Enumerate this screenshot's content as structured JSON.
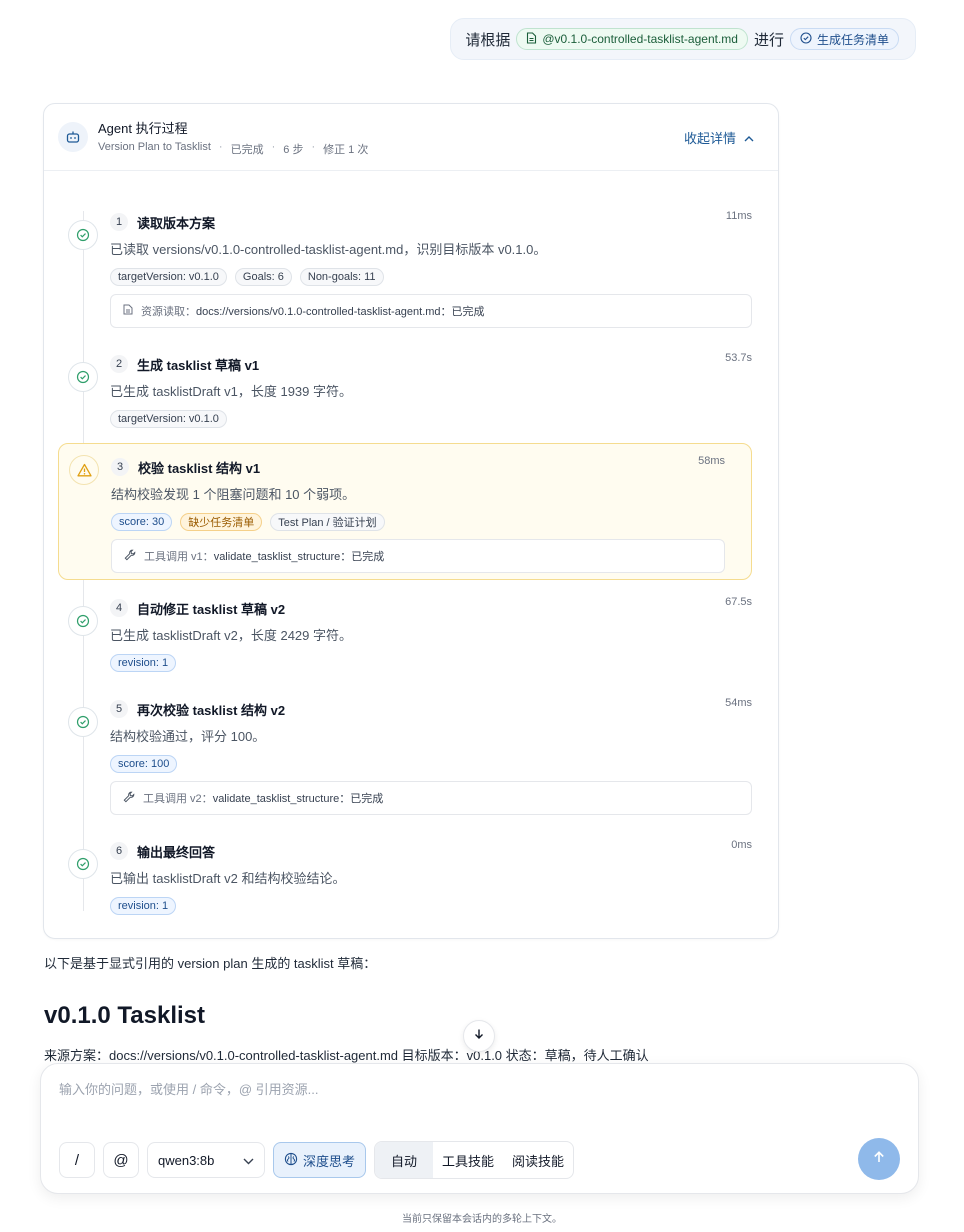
{
  "user_message": {
    "prefix": "请根据",
    "file_chip": "@v0.1.0-controlled-tasklist-agent.md",
    "middle": "进行",
    "action_chip": "生成任务清单"
  },
  "agent": {
    "title": "Agent 执行过程",
    "meta": [
      "Version Plan to Tasklist",
      "已完成",
      "6 步",
      "修正 1 次"
    ],
    "meta_sep": "·",
    "collapse_label": "收起详情",
    "steps": [
      {
        "num": "1",
        "title": "读取版本方案",
        "time": "11ms",
        "status": "done",
        "desc": "已读取 versions/v0.1.0-controlled-tasklist-agent.md，识别目标版本 v0.1.0。",
        "tags": [
          "targetVersion: v0.1.0",
          "Goals: 6",
          "Non-goals: 11"
        ],
        "box_label": "资源读取：",
        "box_value": "docs://versions/v0.1.0-controlled-tasklist-agent.md：已完成"
      },
      {
        "num": "2",
        "title": "生成 tasklist 草稿 v1",
        "time": "53.7s",
        "status": "done",
        "desc": "已生成 tasklistDraft v1，长度 1939 字符。",
        "tags": [
          "targetVersion: v0.1.0"
        ]
      },
      {
        "num": "3",
        "title": "校验 tasklist 结构 v1",
        "time": "58ms",
        "status": "warning",
        "desc": "结构校验发现 1 个阻塞问题和 10 个弱项。",
        "tags": [
          "score: 30",
          "缺少任务清单",
          "Test Plan / 验证计划"
        ],
        "box_label": "工具调用 v1：",
        "box_value": "validate_tasklist_structure：已完成"
      },
      {
        "num": "4",
        "title": "自动修正 tasklist 草稿 v2",
        "time": "67.5s",
        "status": "done",
        "desc": "已生成 tasklistDraft v2，长度 2429 字符。",
        "tags": [
          "revision: 1"
        ]
      },
      {
        "num": "5",
        "title": "再次校验 tasklist 结构 v2",
        "time": "54ms",
        "status": "done",
        "desc": "结构校验通过，评分 100。",
        "tags": [
          "score: 100"
        ],
        "box_label": "工具调用 v2：",
        "box_value": "validate_tasklist_structure：已完成"
      },
      {
        "num": "6",
        "title": "输出最终回答",
        "time": "0ms",
        "status": "done",
        "desc": "已输出 tasklistDraft v2 和结构校验结论。",
        "tags": [
          "revision: 1"
        ]
      }
    ]
  },
  "answer": {
    "intro": "以下是基于显式引用的 version plan 生成的 tasklist 草稿：",
    "heading": "v0.1.0 Tasklist",
    "source_line": "来源方案：docs://versions/v0.1.0-controlled-tasklist-agent.md 目标版本：v0.1.0 状态：草稿，待人工确认"
  },
  "composer": {
    "placeholder": "输入你的问题，或使用 / 命令，@ 引用资源...",
    "slash_label": "/",
    "at_label": "@",
    "model": "qwen3:8b",
    "deep_think_label": "深度思考",
    "modes": [
      "自动",
      "工具技能",
      "阅读技能"
    ],
    "active_mode": "自动"
  },
  "footer_note": "当前只保留本会话内的多轮上下文。",
  "colors": {
    "accent_blue": "#1e5a96",
    "success_green": "#2e9e6a",
    "warning_orange": "#e0a013",
    "send_button": "#8fb9ea"
  },
  "icons": {
    "file": "file-icon",
    "check": "check-circle-icon",
    "bot": "bot-icon",
    "chevron_up": "chevron-up-icon",
    "chevron_down": "chevron-down-icon",
    "warning": "warning-icon",
    "wrench": "wrench-icon",
    "doc": "document-icon",
    "brain": "brain-icon",
    "arrow_up": "arrow-up-icon",
    "arrow_down": "arrow-down-icon"
  }
}
